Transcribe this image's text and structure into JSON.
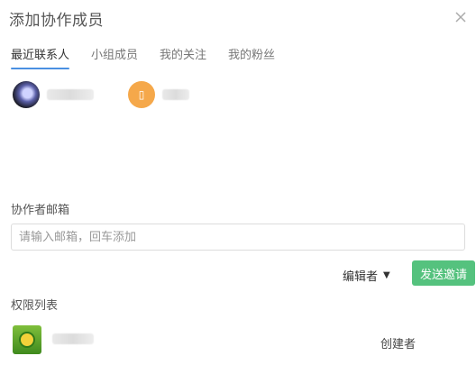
{
  "dialog": {
    "title": "添加协作成员",
    "close_icon": "close-icon"
  },
  "tabs": [
    {
      "label": "最近联系人",
      "active": true
    },
    {
      "label": "小组成员",
      "active": false
    },
    {
      "label": "我的关注",
      "active": false
    },
    {
      "label": "我的粉丝",
      "active": false
    }
  ],
  "contacts": [
    {
      "avatar_style": "dark",
      "name": ""
    },
    {
      "avatar_style": "orange",
      "avatar_glyph": "▯",
      "name": ""
    }
  ],
  "email": {
    "label": "协作者邮箱",
    "placeholder": "请输入邮箱，回车添加",
    "value": ""
  },
  "role_select": {
    "selected": "编辑者",
    "caret": "▼"
  },
  "send_button": {
    "label": "发送邀请",
    "color": "#55c27e"
  },
  "permissions": {
    "label": "权限列表",
    "rows": [
      {
        "name": "",
        "role": "创建者"
      }
    ]
  },
  "colors": {
    "accent": "#4a90e2"
  }
}
